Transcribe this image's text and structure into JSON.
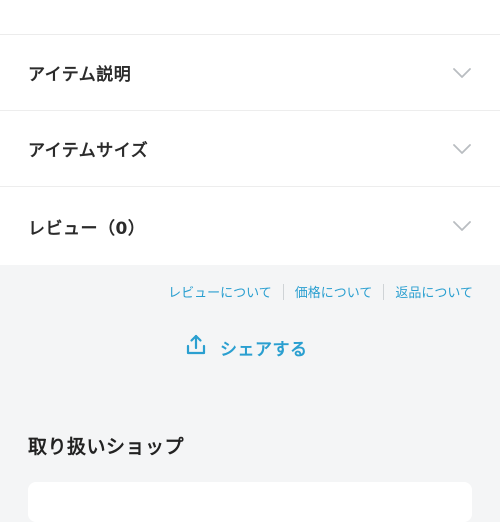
{
  "accordion": {
    "items": [
      {
        "label": "アイテム説明"
      },
      {
        "label": "アイテムサイズ"
      },
      {
        "label": "レビュー（0）"
      }
    ]
  },
  "links": {
    "review": "レビューについて",
    "price": "価格について",
    "returns": "返品について"
  },
  "share": {
    "label": "シェアする",
    "icon": "share-upload-icon"
  },
  "shop": {
    "heading": "取り扱いショップ"
  },
  "colors": {
    "accent": "#2a9fd0",
    "background": "#f4f5f6",
    "chevron": "#b9bdc1"
  }
}
